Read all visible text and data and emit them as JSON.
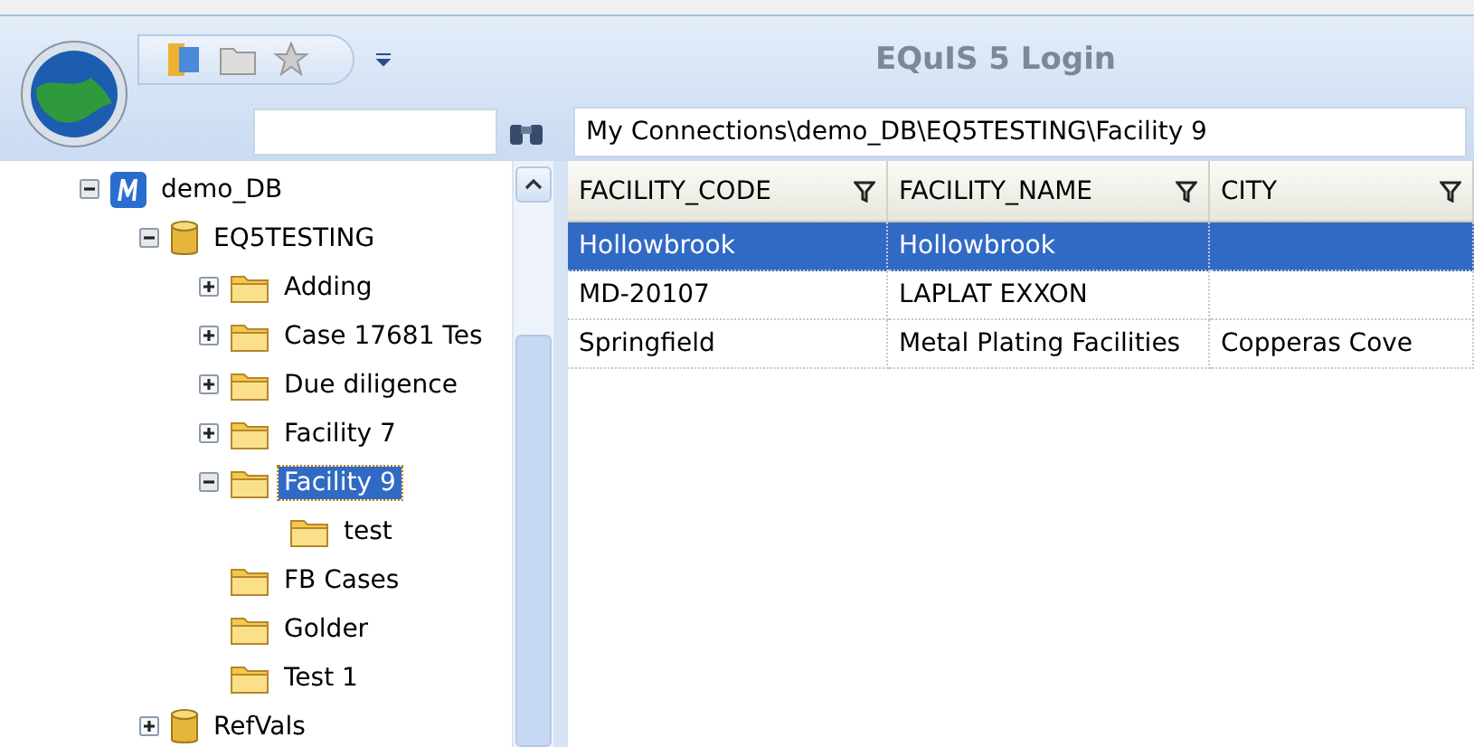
{
  "window": {
    "title": "EQuIS 5 Login"
  },
  "toolbar": {
    "path": {
      "value": "My Connections\\demo_DB\\EQ5TESTING\\Facility 9"
    }
  },
  "tree": [
    {
      "label": "demo_DB",
      "kind": "connection",
      "expanded": true,
      "selected": false,
      "children": [
        {
          "label": "EQ5TESTING",
          "kind": "database",
          "expanded": true,
          "selected": false,
          "children": [
            {
              "label": "Adding",
              "kind": "folder",
              "expanded": false,
              "selected": false
            },
            {
              "label": "Case 17681 Tes",
              "kind": "folder",
              "expanded": false,
              "selected": false
            },
            {
              "label": "Due diligence",
              "kind": "folder",
              "expanded": false,
              "selected": false
            },
            {
              "label": "Facility 7",
              "kind": "folder",
              "expanded": false,
              "selected": false
            },
            {
              "label": "Facility 9",
              "kind": "folder",
              "expanded": true,
              "selected": true,
              "children": [
                {
                  "label": "test",
                  "kind": "folder",
                  "selected": false
                }
              ]
            },
            {
              "label": "FB Cases",
              "kind": "folder",
              "selected": false
            },
            {
              "label": "Golder",
              "kind": "folder",
              "selected": false
            },
            {
              "label": "Test 1",
              "kind": "folder",
              "selected": false
            }
          ]
        },
        {
          "label": "RefVals",
          "kind": "database",
          "expanded": false,
          "selected": false
        }
      ]
    }
  ],
  "table": {
    "columns": [
      "FACILITY_CODE",
      "FACILITY_NAME",
      "CITY"
    ],
    "rows": [
      {
        "cells": [
          "Hollowbrook",
          "Hollowbrook",
          ""
        ],
        "selected": true
      },
      {
        "cells": [
          "MD-20107",
          "LAPLAT EXXON",
          ""
        ],
        "selected": false
      },
      {
        "cells": [
          "Springfield",
          "Metal Plating Facilities",
          "Copperas Cove"
        ],
        "selected": false
      }
    ]
  }
}
